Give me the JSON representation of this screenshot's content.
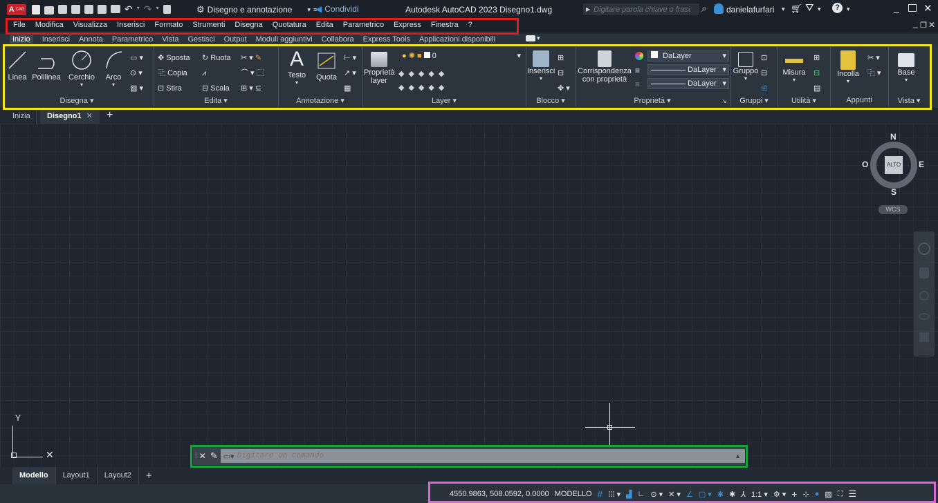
{
  "titlebar": {
    "app_badge": "A",
    "app_badge_sub": "CAD",
    "workspace": "Disegno e annotazione",
    "share": "Condividi",
    "title": "Autodesk AutoCAD 2023  Disegno1.dwg",
    "search_placeholder": "Digitare parola chiave o frase",
    "user": "danielafurfari"
  },
  "menubar": {
    "items": [
      "File",
      "Modifica",
      "Visualizza",
      "Inserisci",
      "Formato",
      "Strumenti",
      "Disegna",
      "Quotatura",
      "Edita",
      "Parametrico",
      "Express",
      "Finestra",
      "?"
    ]
  },
  "ribbon_tabs": {
    "items": [
      "Inizio",
      "Inserisci",
      "Annota",
      "Parametrico",
      "Vista",
      "Gestisci",
      "Output",
      "Moduli aggiuntivi",
      "Collabora",
      "Express Tools",
      "Applicazioni disponibili"
    ],
    "active": "Inizio"
  },
  "ribbon": {
    "draw": {
      "title": "Disegna ▾",
      "linea": "Linea",
      "polilinea": "Polilinea",
      "cerchio": "Cerchio",
      "arco": "Arco"
    },
    "edit": {
      "title": "Edita ▾",
      "sposta": "Sposta",
      "ruota": "Ruota",
      "copia": "Copia",
      "stira": "Stira",
      "scala": "Scala"
    },
    "annotation": {
      "title": "Annotazione ▾",
      "testo": "Testo",
      "quota": "Quota"
    },
    "layer": {
      "title": "Layer ▾",
      "proprieta": "Proprietà",
      "layer": "layer",
      "current": "0"
    },
    "block": {
      "title": "Blocco ▾",
      "inserisci": "Inserisci"
    },
    "properties": {
      "title": "Proprietà ▾",
      "corrisp1": "Corrispondenza",
      "corrisp2": "con proprietà",
      "color": "DaLayer",
      "linetype": "DaLayer",
      "lineweight": "DaLayer"
    },
    "groups": {
      "title": "Gruppi ▾",
      "gruppo": "Gruppo"
    },
    "utility": {
      "title": "Utilità ▾",
      "misura": "Misura"
    },
    "clipboard": {
      "title": "Appunti",
      "incolla": "Incolla"
    },
    "view": {
      "title": "Vista ▾",
      "base": "Base"
    }
  },
  "filetabs": {
    "start": "Inizia",
    "doc": "Disegno1",
    "plus": "+"
  },
  "viewcube": {
    "n": "N",
    "s": "S",
    "e": "E",
    "o": "O",
    "face": "ALTO",
    "wcs": "WCS"
  },
  "ucs": {
    "y": "Y"
  },
  "command": {
    "placeholder": "Digitare un comando"
  },
  "layouttabs": {
    "items": [
      "Modello",
      "Layout1",
      "Layout2"
    ],
    "plus": "+"
  },
  "status": {
    "coords": "4550.9863, 508.0592, 0.0000",
    "space": "MODELLO",
    "scale": "1:1"
  },
  "colors": {
    "accent": "#3a8fd6",
    "highlight_menu": "#e21b1b",
    "highlight_ribbon": "#f3e61a",
    "highlight_command": "#16a53d",
    "highlight_status": "#d76ad6"
  }
}
